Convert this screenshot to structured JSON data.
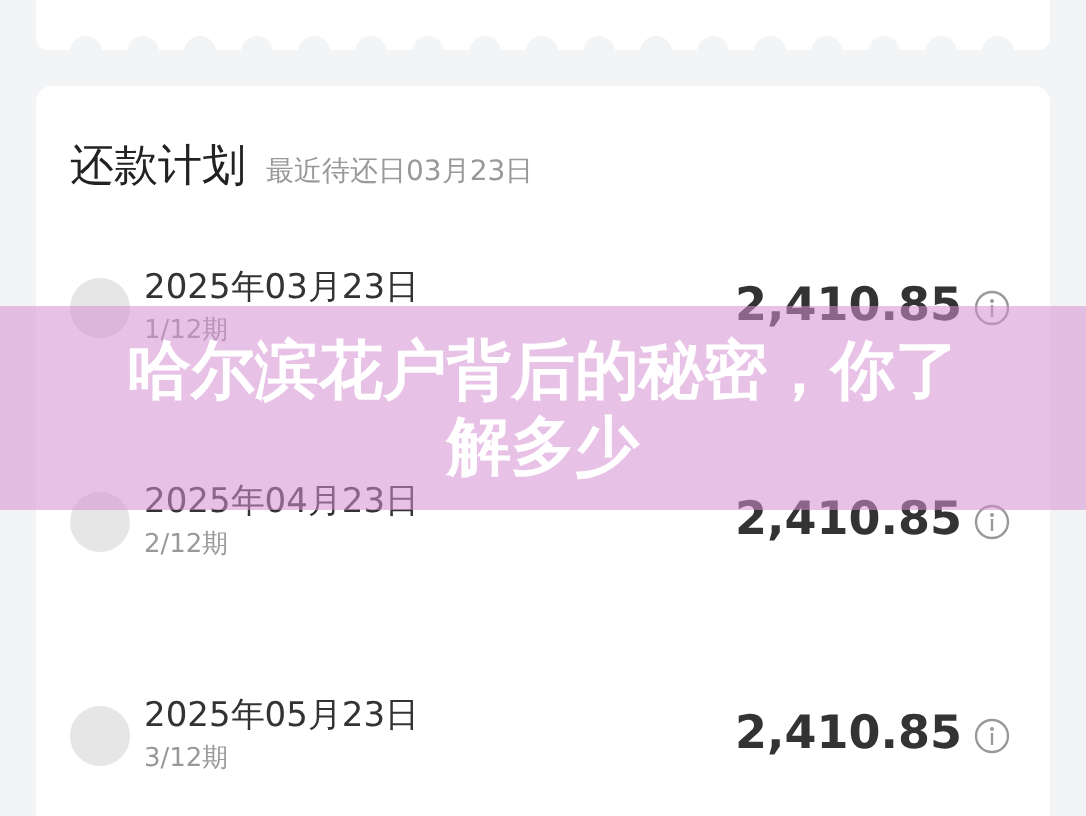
{
  "plan": {
    "title": "还款计划",
    "subtitle": "最近待还日03月23日",
    "rows": [
      {
        "date": "2025年03月23日",
        "period": "1/12期",
        "amount": "2,410.85"
      },
      {
        "date": "2025年04月23日",
        "period": "2/12期",
        "amount": "2,410.85"
      },
      {
        "date": "2025年05月23日",
        "period": "3/12期",
        "amount": "2,410.85"
      }
    ]
  },
  "banner": {
    "title": "哈尔滨花户背后的秘密，你了解多少"
  }
}
